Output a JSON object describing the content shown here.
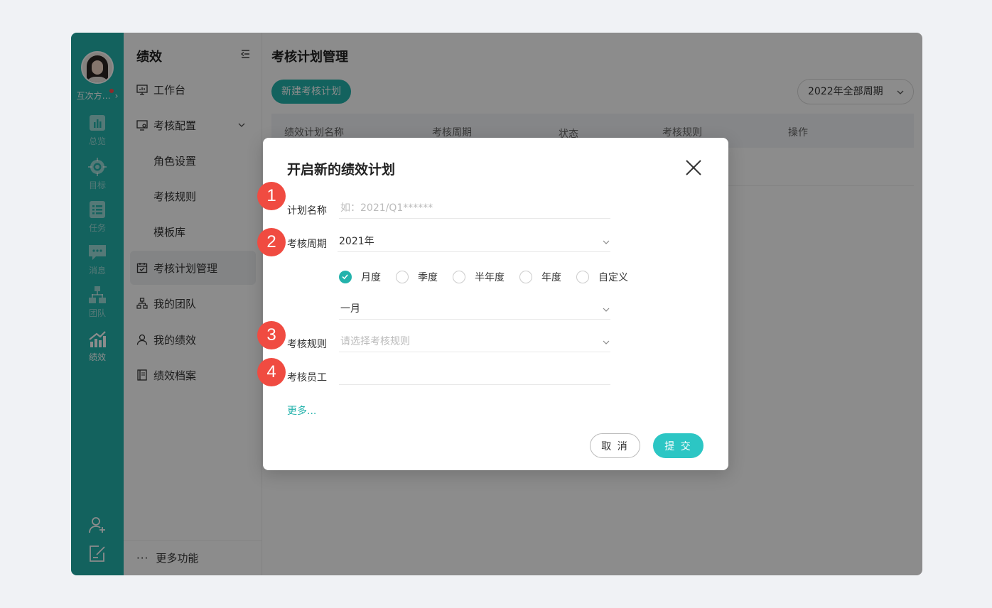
{
  "rail": {
    "user_name": "互次方…",
    "items": [
      {
        "label": "总览",
        "icon": "chart-bars-icon"
      },
      {
        "label": "目标",
        "icon": "target-icon"
      },
      {
        "label": "任务",
        "icon": "task-list-icon"
      },
      {
        "label": "消息",
        "icon": "message-icon"
      },
      {
        "label": "团队",
        "icon": "team-tree-icon"
      },
      {
        "label": "绩效",
        "icon": "performance-chart-icon",
        "active": true
      }
    ],
    "bottom_icons": [
      "add-user-icon",
      "edit-icon"
    ]
  },
  "subnav": {
    "title": "绩效",
    "items": [
      {
        "label": "工作台",
        "icon": "monitor-icon"
      },
      {
        "label": "考核配置",
        "icon": "config-monitor-icon",
        "expanded": true
      },
      {
        "label": "角色设置"
      },
      {
        "label": "考核规则"
      },
      {
        "label": "模板库"
      },
      {
        "label": "考核计划管理",
        "icon": "calendar-check-icon",
        "active": true
      },
      {
        "label": "我的团队",
        "icon": "org-chart-icon"
      },
      {
        "label": "我的绩效",
        "icon": "person-icon"
      },
      {
        "label": "绩效档案",
        "icon": "file-icon"
      }
    ],
    "footer": "更多功能"
  },
  "main": {
    "title": "考核计划管理",
    "new_button": "新建考核计划",
    "period_select": "2022年全部周期",
    "columns": [
      "绩效计划名称",
      "考核周期",
      "状态",
      "考核规则",
      "操作"
    ]
  },
  "modal": {
    "title": "开启新的绩效计划",
    "name_label": "计划名称",
    "name_placeholder": "如：2021/Q1******",
    "period_label": "考核周期",
    "period_value": "2021年",
    "period_types": [
      {
        "label": "月度",
        "checked": true
      },
      {
        "label": "季度",
        "checked": false
      },
      {
        "label": "半年度",
        "checked": false
      },
      {
        "label": "年度",
        "checked": false
      },
      {
        "label": "自定义",
        "checked": false
      }
    ],
    "month_value": "一月",
    "rule_label": "考核规则",
    "rule_placeholder": "请选择考核规则",
    "employee_label": "考核员工",
    "employee_value": "",
    "more": "更多...",
    "cancel": "取 消",
    "submit": "提 交"
  },
  "annotations": [
    "1",
    "2",
    "3",
    "4"
  ],
  "colors": {
    "accent": "#24b3ac",
    "badge": "#f04b41",
    "submit": "#2cc6c4"
  }
}
